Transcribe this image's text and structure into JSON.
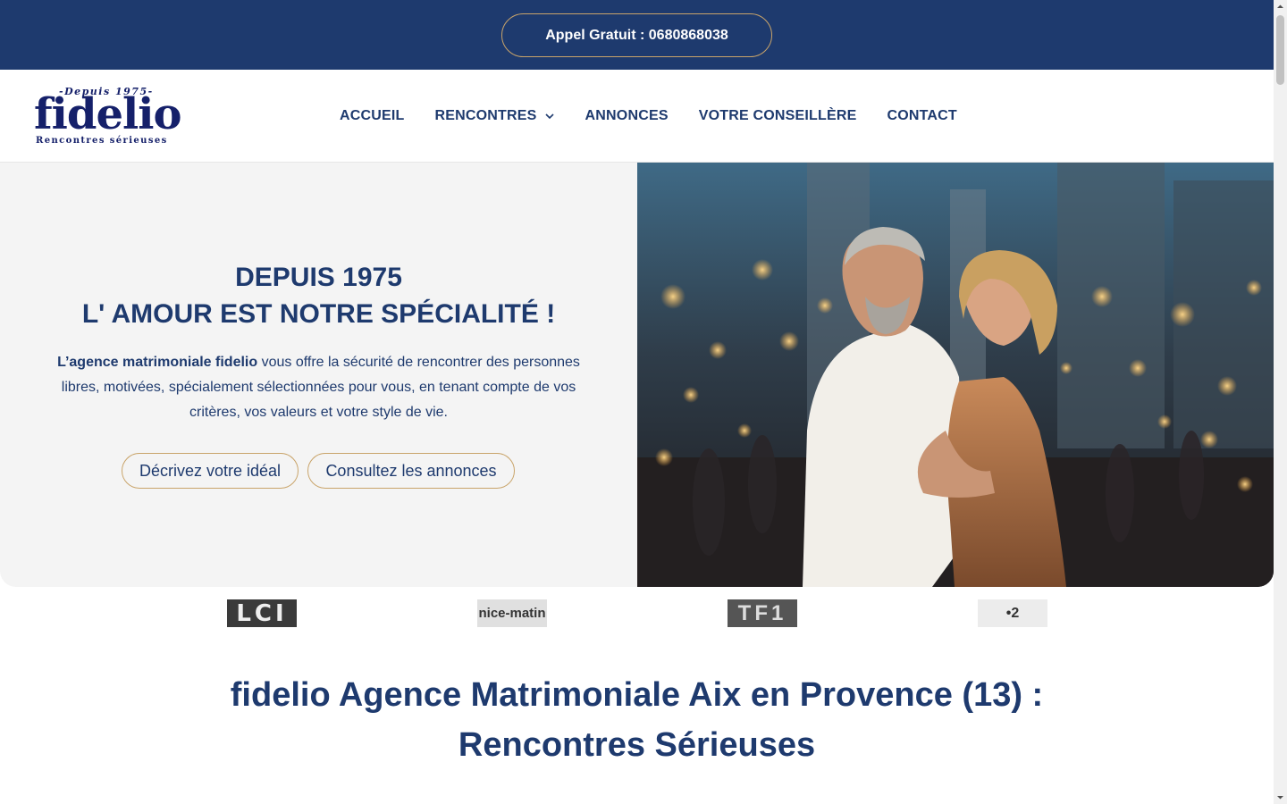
{
  "topbar": {
    "call_label": "Appel Gratuit : 0680868038"
  },
  "logo": {
    "top": "-Depuis 1975-",
    "main": "fidelio",
    "sub": "Rencontres sérieuses"
  },
  "nav": {
    "items": [
      {
        "label": "ACCUEIL"
      },
      {
        "label": "RENCONTRES",
        "has_dropdown": true
      },
      {
        "label": "ANNONCES"
      },
      {
        "label": "VOTRE CONSEILLÈRE"
      },
      {
        "label": "CONTACT"
      }
    ]
  },
  "hero": {
    "title_line1": "DEPUIS 1975",
    "title_line2": "L' AMOUR EST NOTRE SPÉCIALITÉ !",
    "text_bold": "L’agence matrimoniale fidelio",
    "text_rest": " vous offre la sécurité de rencontrer des personnes libres, motivées, spécialement sélectionnées pour vous, en tenant compte de vos critères, vos valeurs et votre style de vie.",
    "cta_primary": "Décrivez votre idéal",
    "cta_secondary": "Consultez les annonces"
  },
  "press": {
    "logos": [
      {
        "name": "LCI",
        "text": "LCI"
      },
      {
        "name": "nice-matin",
        "text": "nice-matin"
      },
      {
        "name": "TF1",
        "text": "TF1"
      },
      {
        "name": "France 2",
        "text": "•2"
      }
    ]
  },
  "main": {
    "heading_line1": "fidelio Agence Matrimoniale Aix en Provence (13) :",
    "heading_line2": "Rencontres Sérieuses"
  },
  "colors": {
    "primary": "#1e3a6e",
    "accent": "#c9a46a",
    "hero_bg": "#f4f4f4"
  }
}
